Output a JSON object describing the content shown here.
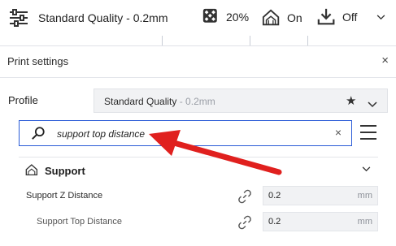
{
  "topbar": {
    "profile_label": "Standard Quality - 0.2mm",
    "infill_value": "20%",
    "support_state": "On",
    "adhesion_state": "Off",
    "icons": [
      "settings-sliders-icon",
      "infill-icon",
      "support-icon",
      "adhesion-icon",
      "chevron-down-icon"
    ]
  },
  "panel": {
    "title": "Print settings",
    "close_glyph": "×"
  },
  "profile": {
    "label": "Profile",
    "name": "Standard Quality",
    "suffix": " - 0.2mm",
    "star_glyph": "★"
  },
  "search": {
    "value": "support top distance",
    "clear_glyph": "×",
    "border_color": "#2a5bd7"
  },
  "category": {
    "label": "Support"
  },
  "settings": [
    {
      "label": "Support Z Distance",
      "value": "0.2",
      "unit": "mm"
    },
    {
      "label": "Support Top Distance",
      "value": "0.2",
      "unit": "mm"
    }
  ],
  "annotation": {
    "arrow_color": "#e0201e"
  }
}
